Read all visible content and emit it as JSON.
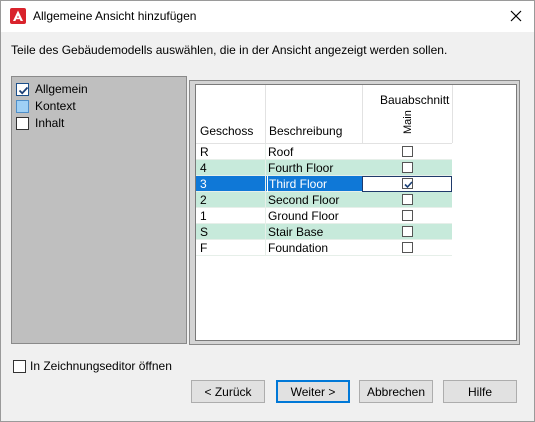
{
  "window": {
    "title": "Allgemeine Ansicht hinzufügen",
    "close_glyph": "✕",
    "accent_red": "#d9232c"
  },
  "instruction": "Teile des Gebäudemodells auswählen, die in der Ansicht angezeigt werden sollen.",
  "tree": {
    "items": [
      {
        "label": "Allgemein",
        "state": "checked"
      },
      {
        "label": "Kontext",
        "state": "partial"
      },
      {
        "label": "Inhalt",
        "state": "unchecked"
      }
    ]
  },
  "grid": {
    "group_header": "Bauabschnitt",
    "columns": {
      "level": "Geschoss",
      "description": "Beschreibung",
      "phase": "Main"
    },
    "rows": [
      {
        "level": "R",
        "description": "Roof",
        "checked": false
      },
      {
        "level": "4",
        "description": "Fourth Floor",
        "checked": false
      },
      {
        "level": "3",
        "description": "Third Floor",
        "checked": true
      },
      {
        "level": "2",
        "description": "Second Floor",
        "checked": false
      },
      {
        "level": "1",
        "description": "Ground Floor",
        "checked": false
      },
      {
        "level": "S",
        "description": "Stair Base",
        "checked": false
      },
      {
        "level": "F",
        "description": "Foundation",
        "checked": false
      }
    ],
    "selected_row": 2,
    "alt_row_color": "#c7eadb",
    "selection_color": "#0f78d7"
  },
  "bottom": {
    "open_editor_label": "In Zeichnungseditor öffnen",
    "open_editor_checked": false
  },
  "buttons": {
    "back": "< Zurück",
    "next": "Weiter >",
    "cancel": "Abbrechen",
    "help": "Hilfe"
  }
}
